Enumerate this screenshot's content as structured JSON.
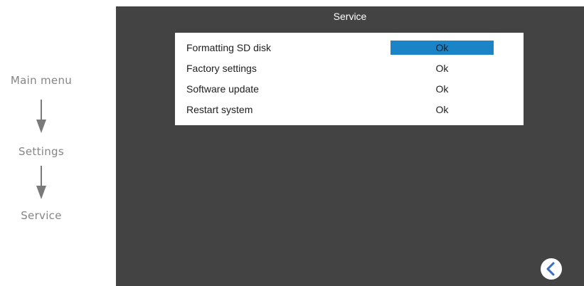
{
  "flow": {
    "steps": [
      "Main menu",
      "Settings",
      "Service"
    ]
  },
  "screen": {
    "title": "Service",
    "rows": [
      {
        "label": "Formatting SD disk",
        "button": "Ok",
        "selected": true
      },
      {
        "label": "Factory settings",
        "button": "Ok",
        "selected": false
      },
      {
        "label": "Software update",
        "button": "Ok",
        "selected": false
      },
      {
        "label": "Restart system",
        "button": "Ok",
        "selected": false
      }
    ],
    "back_icon": "chevron-left-icon"
  },
  "colors": {
    "screen_bg": "#434343",
    "panel_bg": "#ffffff",
    "selected_bg": "#1a84c7",
    "flow_text": "#858585",
    "back_icon": "#3a6cc0"
  }
}
